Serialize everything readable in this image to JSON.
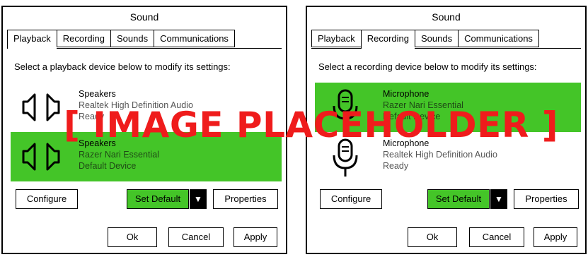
{
  "placeholder_text": "[ IMAGE PLACEHOLDER ]",
  "colors": {
    "selected_green": "#44c528",
    "overlay_red": "#ef1c1c"
  },
  "left_dialog": {
    "title": "Sound",
    "tabs": [
      "Playback",
      "Recording",
      "Sounds",
      "Communications"
    ],
    "active_tab": "Playback",
    "instruction": "Select a playback device below to modify its settings:",
    "devices": [
      {
        "name": "Speakers",
        "description": "Realtek High Definition Audio",
        "status": "Ready",
        "icon": "speaker-icon",
        "selected": false
      },
      {
        "name": "Speakers",
        "description": "Razer Nari Essential",
        "status": "Default Device",
        "icon": "speaker-icon",
        "selected": true
      }
    ],
    "buttons": {
      "configure": "Configure",
      "set_default": "Set Default",
      "dropdown": "▼",
      "properties": "Properties",
      "ok": "Ok",
      "cancel": "Cancel",
      "apply": "Apply"
    }
  },
  "right_dialog": {
    "title": "Sound",
    "tabs": [
      "Playback",
      "Recording",
      "Sounds",
      "Communications"
    ],
    "active_tab": "Recording",
    "instruction": "Select a recording device below to modify its settings:",
    "devices": [
      {
        "name": "Microphone",
        "description": "Razer Nari Essential",
        "status": "Default Device",
        "icon": "microphone-icon",
        "selected": true
      },
      {
        "name": "Microphone",
        "description": "Realtek High Definition Audio",
        "status": "Ready",
        "icon": "microphone-icon",
        "selected": false
      }
    ],
    "buttons": {
      "configure": "Configure",
      "set_default": "Set Default",
      "dropdown": "▼",
      "properties": "Properties",
      "ok": "Ok",
      "cancel": "Cancel",
      "apply": "Apply"
    }
  }
}
